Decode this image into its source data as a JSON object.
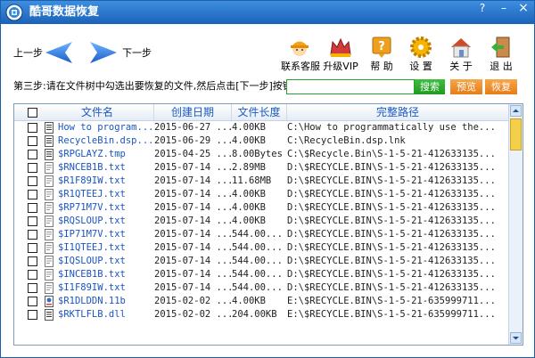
{
  "window": {
    "title": "酷哥数据恢复",
    "help_btn": "?",
    "min_btn": "–",
    "close_btn": "×"
  },
  "nav": {
    "prev_label": "上一步",
    "next_label": "下一步"
  },
  "toolbar": [
    {
      "label": "联系客服",
      "icon": "service-icon",
      "color": "#f2a31b"
    },
    {
      "label": "升级VIP",
      "icon": "crown-icon",
      "color": "#d23b3b"
    },
    {
      "label": "帮 助",
      "icon": "help-icon",
      "color": "#f0a020"
    },
    {
      "label": "设 置",
      "icon": "gear-icon",
      "color": "#f4b400"
    },
    {
      "label": "关 于",
      "icon": "house-icon",
      "color": "#d04a2a"
    },
    {
      "label": "退 出",
      "icon": "exit-icon",
      "color": "#3cae3c"
    }
  ],
  "step_text": "第三步:请在文件树中勾选出要恢复的文件,然后点击[下一步]按钮",
  "search": {
    "value": "",
    "button": "搜索"
  },
  "actions": {
    "preview": "预览",
    "recover": "恢复"
  },
  "colors": {
    "accent": "#1b62b9",
    "link": "#1a55c0",
    "green": "#1f9a1f",
    "orange": "#e77d16"
  },
  "table": {
    "headers": [
      "文件名",
      "创建日期",
      "文件长度",
      "完整路径"
    ],
    "rows": [
      {
        "name": "How to program...",
        "date": "2015-06-27 ...",
        "size": "4.00KB",
        "path": "C:\\How to programmatically use the...",
        "icon": "doc"
      },
      {
        "name": "RecycleBin.dsp...",
        "date": "2015-06-29 ...",
        "size": "4.00KB",
        "path": "C:\\RecycleBin.dsp.lnk",
        "icon": "doc"
      },
      {
        "name": "$RPGLAYZ.tmp",
        "date": "2015-04-25 ...",
        "size": "8.00Bytes",
        "path": "C:\\$Recycle.Bin\\S-1-5-21-412633135...",
        "icon": "doc"
      },
      {
        "name": "$RNCEB1B.txt",
        "date": "2015-07-14 ...",
        "size": "2.89MB",
        "path": "D:\\$RECYCLE.BIN\\S-1-5-21-412633135...",
        "icon": "txt"
      },
      {
        "name": "$R1F89IW.txt",
        "date": "2015-07-14 ...",
        "size": "11.68MB",
        "path": "D:\\$RECYCLE.BIN\\S-1-5-21-412633135...",
        "icon": "txt"
      },
      {
        "name": "$R1QTEEJ.txt",
        "date": "2015-07-14 ...",
        "size": "4.00KB",
        "path": "D:\\$RECYCLE.BIN\\S-1-5-21-412633135...",
        "icon": "txt"
      },
      {
        "name": "$RP71M7V.txt",
        "date": "2015-07-14 ...",
        "size": "4.00KB",
        "path": "D:\\$RECYCLE.BIN\\S-1-5-21-412633135...",
        "icon": "txt"
      },
      {
        "name": "$RQSLOUP.txt",
        "date": "2015-07-14 ...",
        "size": "4.00KB",
        "path": "D:\\$RECYCLE.BIN\\S-1-5-21-412633135...",
        "icon": "txt"
      },
      {
        "name": "$IP71M7V.txt",
        "date": "2015-07-14 ...",
        "size": "544.00...",
        "path": "D:\\$RECYCLE.BIN\\S-1-5-21-412633135...",
        "icon": "txt"
      },
      {
        "name": "$I1QTEEJ.txt",
        "date": "2015-07-14 ...",
        "size": "544.00...",
        "path": "D:\\$RECYCLE.BIN\\S-1-5-21-412633135...",
        "icon": "txt"
      },
      {
        "name": "$IQSLOUP.txt",
        "date": "2015-07-14 ...",
        "size": "544.00...",
        "path": "D:\\$RECYCLE.BIN\\S-1-5-21-412633135...",
        "icon": "txt"
      },
      {
        "name": "$INCEB1B.txt",
        "date": "2015-07-14 ...",
        "size": "544.00...",
        "path": "D:\\$RECYCLE.BIN\\S-1-5-21-412633135...",
        "icon": "txt"
      },
      {
        "name": "$I1F89IW.txt",
        "date": "2015-07-14 ...",
        "size": "544.00...",
        "path": "D:\\$RECYCLE.BIN\\S-1-5-21-412633135...",
        "icon": "txt"
      },
      {
        "name": "$R1DLDDN.11b",
        "date": "2015-02-02 ...",
        "size": "4.00KB",
        "path": "E:\\$RECYCLE.BIN\\S-1-5-21-635999711...",
        "icon": "lib"
      },
      {
        "name": "$RKTLFLB.dll",
        "date": "2015-02-02 ...",
        "size": "204.00KB",
        "path": "E:\\$RECYCLE.BIN\\S-1-5-21-635999711...",
        "icon": "doc"
      }
    ]
  }
}
